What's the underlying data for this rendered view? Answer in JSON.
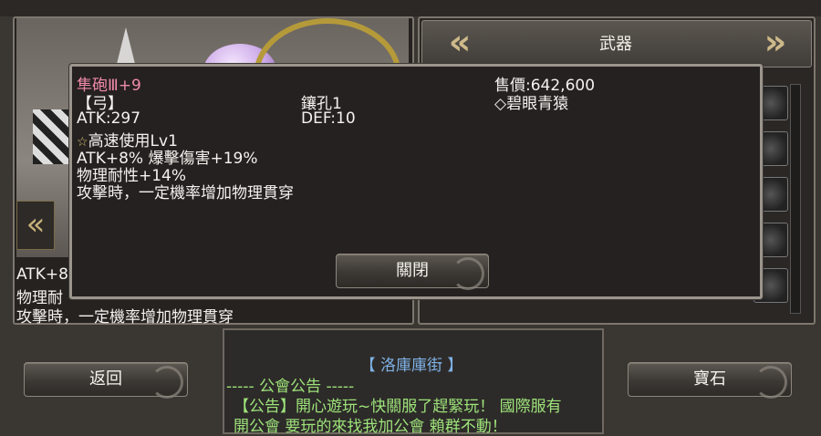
{
  "left_panel": {
    "stat_line": "ATK+8",
    "phys_line": "物理耐",
    "effect_line": "攻擊時，一定機率增加物理貫穿"
  },
  "right_panel": {
    "header_title": "武器",
    "prev_icon": "double-chevron-left-icon",
    "next_icon": "double-chevron-right-icon"
  },
  "tooltip": {
    "name": "隼砲Ⅲ+9",
    "type": "【弓】",
    "price": "售價:642,600",
    "source": "◇碧眼青猿",
    "sockets": "鑲孔1",
    "atk": "ATK:297",
    "def": "DEF:10",
    "skill": "高速使用Lv1",
    "bonus1": "ATK+8%  爆擊傷害+19%",
    "bonus2": "物理耐性+14%",
    "bonus3": "攻擊時，一定機率增加物理貫穿",
    "close_label": "關閉"
  },
  "bottom": {
    "back_label": "返回",
    "gem_label": "寶石",
    "location": "【  洛庫庫街  】",
    "guild_header": "-----  公會公告  -----",
    "notice1": "【公告】開心遊玩~快關服了趕緊玩！  國際服有",
    "notice2": "開公會  要玩的來找我加公會  賴群不動！"
  },
  "colors": {
    "item_name": "#f08aa8",
    "location_text": "#7fb2e6",
    "guild_text": "#9ee37a"
  }
}
